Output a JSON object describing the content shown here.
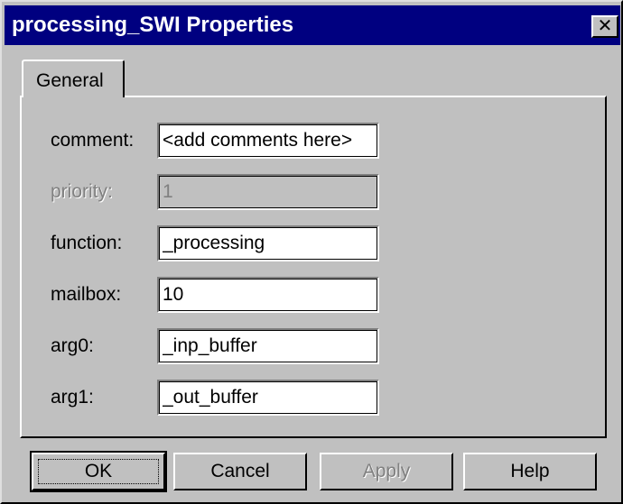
{
  "window": {
    "title": "processing_SWI Properties",
    "close_glyph": "✕"
  },
  "tabs": [
    {
      "label": "General",
      "selected": true
    }
  ],
  "fields": {
    "comment": {
      "label": "comment:",
      "value": "<add comments here>",
      "enabled": true
    },
    "priority": {
      "label": "priority:",
      "value": "1",
      "enabled": false
    },
    "function": {
      "label": "function:",
      "value": "_processing",
      "enabled": true
    },
    "mailbox": {
      "label": "mailbox:",
      "value": "10",
      "enabled": true
    },
    "arg0": {
      "label": "arg0:",
      "value": "_inp_buffer",
      "enabled": true
    },
    "arg1": {
      "label": "arg1:",
      "value": "_out_buffer",
      "enabled": true
    }
  },
  "buttons": {
    "ok": {
      "label": "OK",
      "enabled": true,
      "default": true
    },
    "cancel": {
      "label": "Cancel",
      "enabled": true
    },
    "apply": {
      "label": "Apply",
      "enabled": false
    },
    "help": {
      "label": "Help",
      "enabled": true
    }
  },
  "colors": {
    "titlebar": "#000080",
    "face": "#c0c0c0",
    "disabled_text": "#808080"
  }
}
